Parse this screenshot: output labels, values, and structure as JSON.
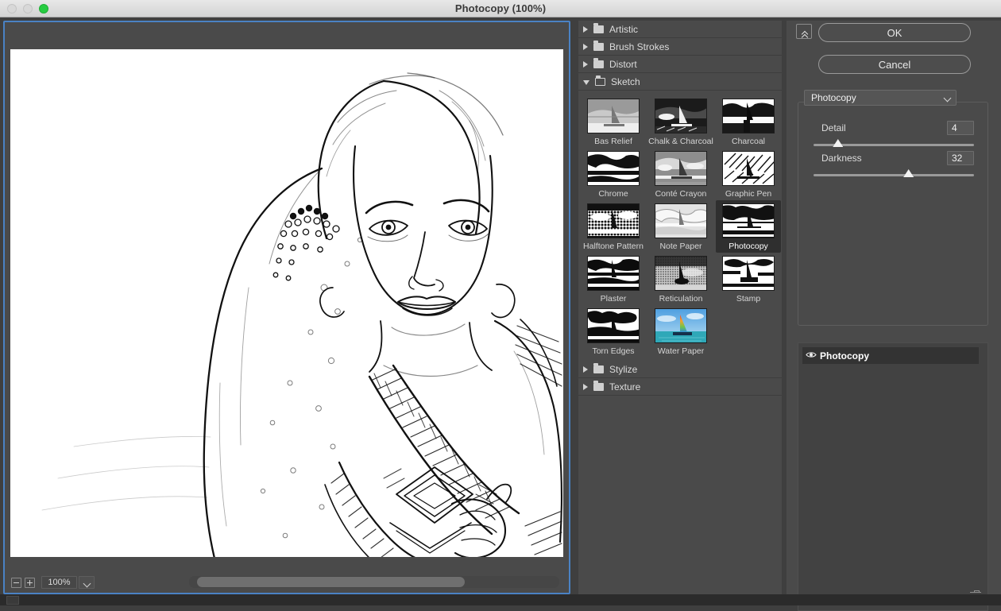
{
  "window": {
    "title": "Photocopy (100%)",
    "traffic_lights": [
      "close-disabled",
      "minimize-disabled",
      "zoom-green"
    ]
  },
  "preview": {
    "zoom_out_label": "−",
    "zoom_in_label": "+",
    "zoom_value": "100%",
    "zoom_dropdown": "zoom-preset-chevron",
    "scrollbar": "horizontal-scrollbar",
    "image_alt": "Photocopy-filtered portrait of a woman in a fur coat with a knitted scarf"
  },
  "filter_browser": {
    "folders": [
      {
        "label": "Artistic",
        "expanded": false
      },
      {
        "label": "Brush Strokes",
        "expanded": false
      },
      {
        "label": "Distort",
        "expanded": false
      },
      {
        "label": "Sketch",
        "expanded": true
      },
      {
        "label": "Stylize",
        "expanded": false
      },
      {
        "label": "Texture",
        "expanded": false
      }
    ],
    "sketch_filters": [
      {
        "label": "Bas Relief",
        "selected": false,
        "style": "relief"
      },
      {
        "label": "Chalk & Charcoal",
        "selected": false,
        "style": "chalk"
      },
      {
        "label": "Charcoal",
        "selected": false,
        "style": "charcoal"
      },
      {
        "label": "Chrome",
        "selected": false,
        "style": "chrome"
      },
      {
        "label": "Conté Crayon",
        "selected": false,
        "style": "conte"
      },
      {
        "label": "Graphic Pen",
        "selected": false,
        "style": "gpen"
      },
      {
        "label": "Halftone Pattern",
        "selected": false,
        "style": "halftone"
      },
      {
        "label": "Note Paper",
        "selected": false,
        "style": "note"
      },
      {
        "label": "Photocopy",
        "selected": true,
        "style": "photocopy"
      },
      {
        "label": "Plaster",
        "selected": false,
        "style": "plaster"
      },
      {
        "label": "Reticulation",
        "selected": false,
        "style": "retic"
      },
      {
        "label": "Stamp",
        "selected": false,
        "style": "stamp"
      },
      {
        "label": "Torn Edges",
        "selected": false,
        "style": "torn"
      },
      {
        "label": "Water Paper",
        "selected": false,
        "style": "water"
      }
    ]
  },
  "options": {
    "collapse_button": "collapse-panel",
    "ok_label": "OK",
    "cancel_label": "Cancel",
    "filter_select_value": "Photocopy",
    "sliders": [
      {
        "label": "Detail",
        "value": "4",
        "percent": 15
      },
      {
        "label": "Darkness",
        "value": "32",
        "percent": 59
      }
    ]
  },
  "layers": {
    "items": [
      {
        "name": "Photocopy",
        "visible": true
      }
    ],
    "new_layer_label": "new-effect-layer",
    "delete_label": "delete-effect-layer"
  },
  "colors": {
    "accent_focus": "#4a82c4",
    "panel_bg": "#4a4a4a",
    "selected_cell": "#2f2f2f",
    "titlebar": "#dedede"
  }
}
